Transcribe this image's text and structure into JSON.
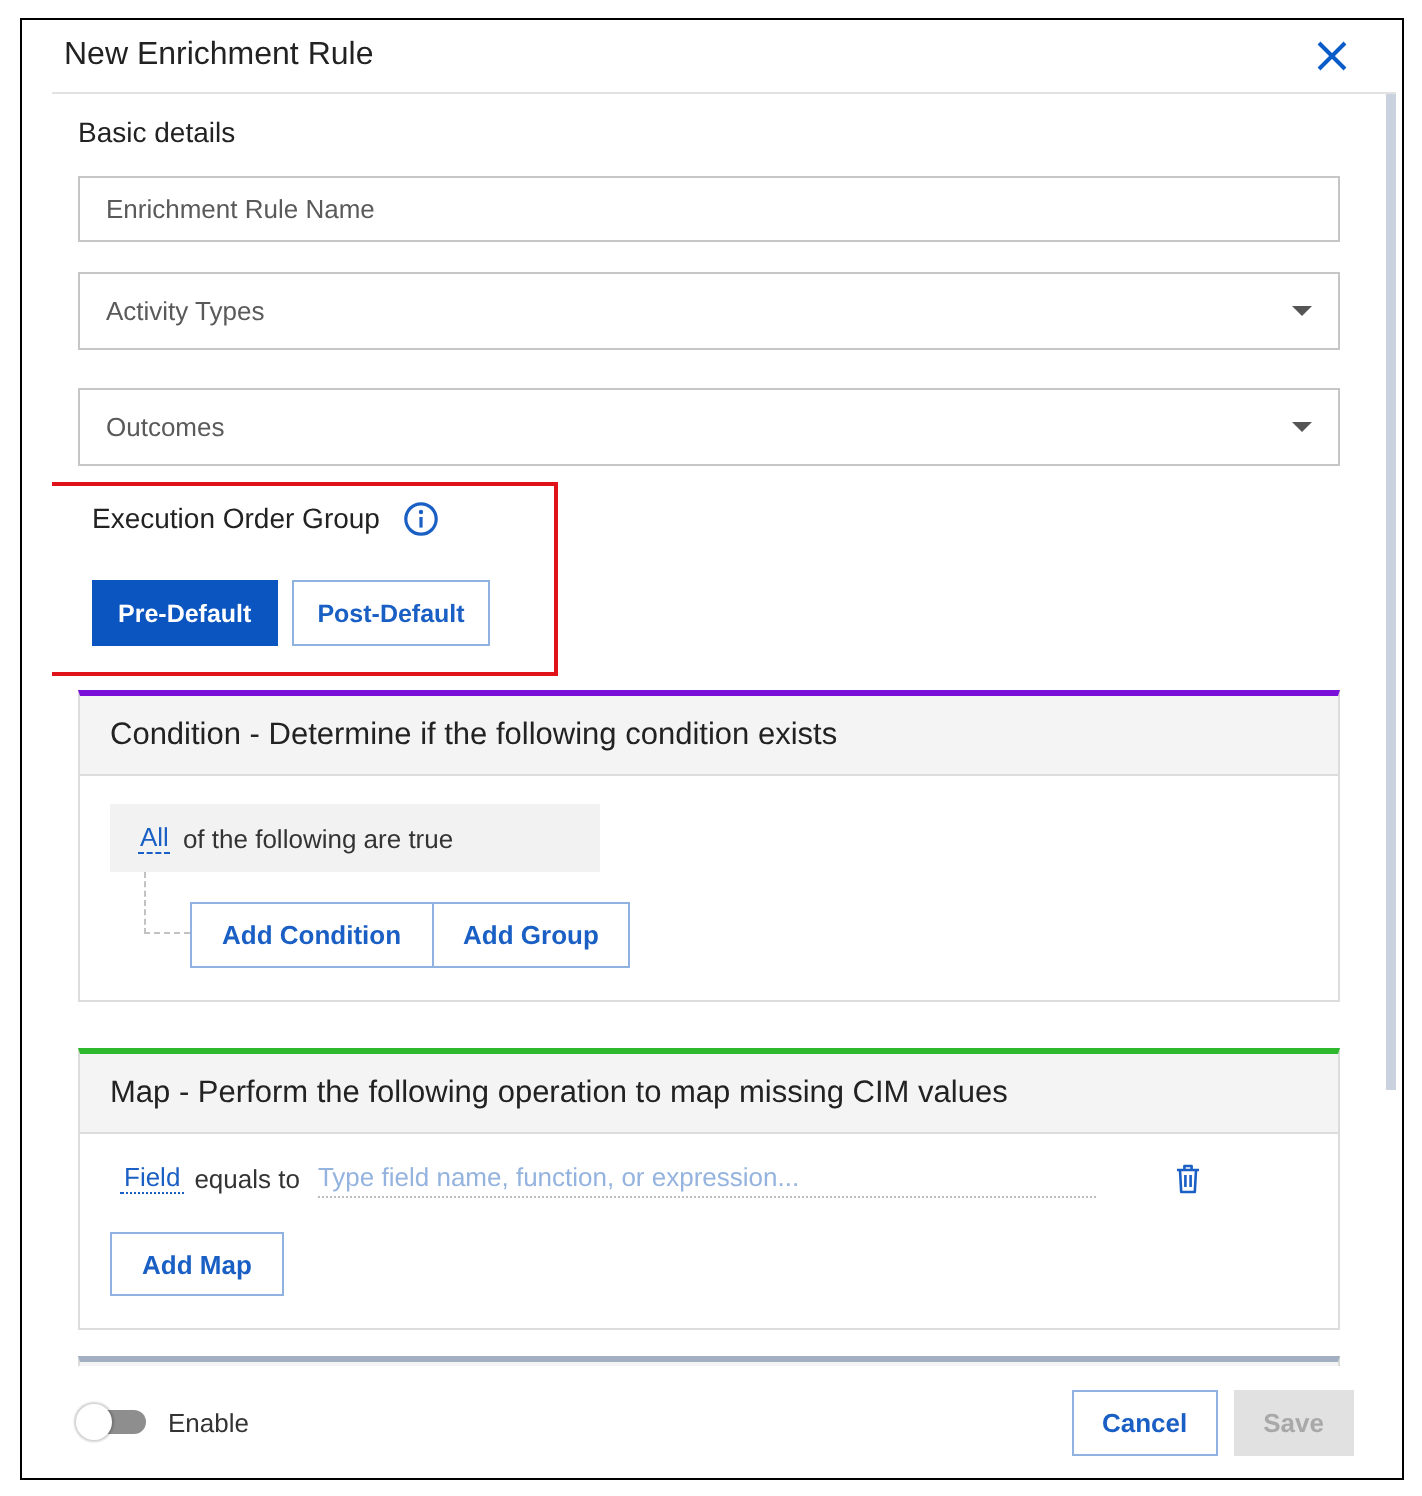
{
  "dialog": {
    "title": "New Enrichment Rule"
  },
  "basic_details": {
    "heading": "Basic details",
    "name_field": {
      "placeholder": "Enrichment Rule Name"
    },
    "selects": [
      {
        "placeholder": "Activity Types"
      },
      {
        "placeholder": "Outcomes"
      }
    ]
  },
  "execution_order_group": {
    "label": "Execution Order Group",
    "highlighted": true,
    "options": [
      {
        "label": "Pre-Default",
        "selected": true
      },
      {
        "label": "Post-Default",
        "selected": false
      }
    ]
  },
  "sections": [
    {
      "kind": "condition",
      "color": "#7a0fd9",
      "title": "Condition - Determine if the following condition exists",
      "quantifier": "All",
      "quantifier_text": "of the following are true",
      "buttons": [
        "Add Condition",
        "Add Group"
      ]
    },
    {
      "kind": "map",
      "color": "#2db82d",
      "title": "Map - Perform the following operation to map missing CIM values",
      "mappings": [
        {
          "field": "Field",
          "operator": "equals to",
          "placeholder": "Type field name, function, or expression..."
        }
      ],
      "button": "Add Map"
    },
    {
      "kind": "cut_off",
      "color": "#a3afc2"
    }
  ],
  "footer": {
    "enable": {
      "label": "Enable",
      "on": false
    },
    "buttons": [
      {
        "label": "Cancel",
        "kind": "secondary",
        "disabled": false
      },
      {
        "label": "Save",
        "kind": "primary",
        "disabled": true
      }
    ]
  }
}
